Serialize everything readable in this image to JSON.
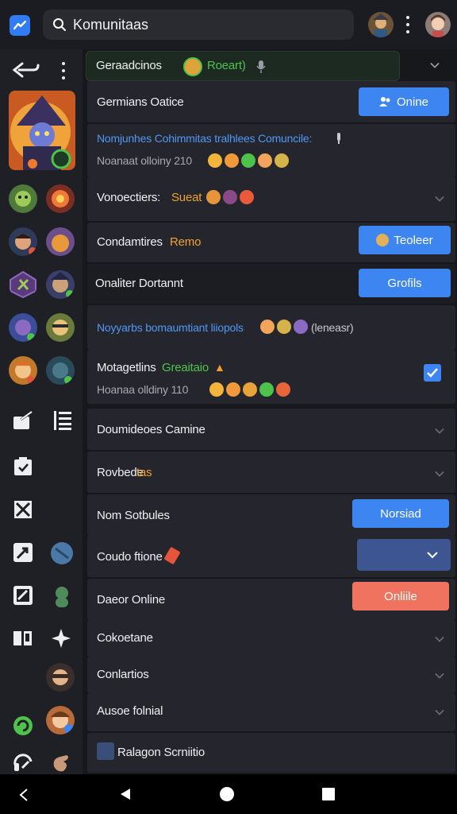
{
  "topbar": {
    "search_text": "Komunitaas",
    "app_icon": "messenger-icon"
  },
  "header_row": {
    "label": "Geraadcinos",
    "status_text": "Roeart)",
    "mic_icon": "mic-icon"
  },
  "rows": [
    {
      "label": "Germians Oatice",
      "button": "Onine"
    },
    {
      "title": "Nomjunhes Cohimmitas tralhlees Comuncile:",
      "sub": "Noanaat olloiny 210"
    },
    {
      "label": "Vonoectiers:",
      "accent": "Sueat"
    },
    {
      "label": "Condamtires",
      "accent": "Remo",
      "button": "Teoleer"
    },
    {
      "label": "Onaliter Dortannt",
      "button": "Grofils"
    },
    {
      "title": "Noyyarbs bomaumtiant liiopols",
      "suffix": "(leneasr)"
    },
    {
      "label": "Motagetlins",
      "accent": "Greaitaio",
      "sub": "Hoanaa olldiny 110",
      "checked": true
    },
    {
      "label": "Doumideoes Camine"
    },
    {
      "label": "Rovbede",
      "accent": "tas"
    },
    {
      "label": "Nom Sotbules",
      "button": "Norsiad"
    },
    {
      "label": "Coudo ftione"
    },
    {
      "label": "Daeor Online",
      "button": "Onliile"
    },
    {
      "label": "Cokoetane"
    },
    {
      "label": "Conlartios"
    },
    {
      "label": "Ausoe folnial"
    },
    {
      "label": "Ralagon Scrniitio"
    }
  ],
  "colors": {
    "accent_blue": "#3d86f1",
    "coral": "#f0735f",
    "green": "#4ec34b",
    "orange": "#f0a12c"
  }
}
